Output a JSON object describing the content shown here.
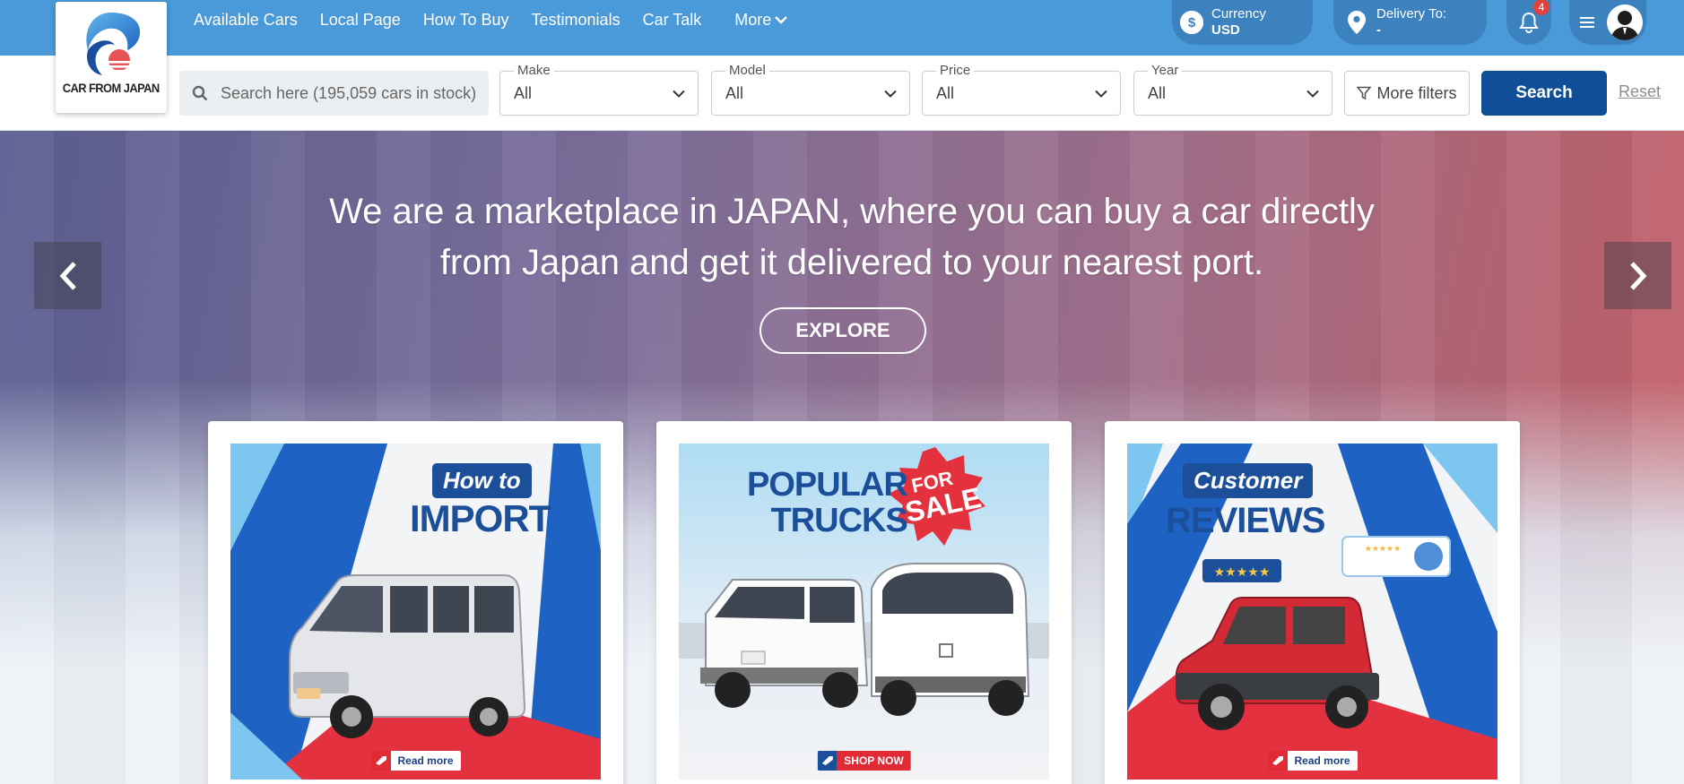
{
  "brand": {
    "logo_text": "CAR FROM JAPAN"
  },
  "nav": {
    "items": [
      "Available Cars",
      "Local Page",
      "How To Buy",
      "Testimonials",
      "Car Talk"
    ],
    "more_label": "More"
  },
  "header": {
    "currency_label": "Currency",
    "currency_value": "USD",
    "delivery_label": "Delivery To:",
    "delivery_value": "-",
    "notification_count": "4"
  },
  "search": {
    "placeholder": "Search here (195,059 cars in stock)",
    "filters": [
      {
        "label": "Make",
        "value": "All"
      },
      {
        "label": "Model",
        "value": "All"
      },
      {
        "label": "Price",
        "value": "All"
      },
      {
        "label": "Year",
        "value": "All"
      }
    ],
    "more_filters_label": "More filters",
    "search_label": "Search",
    "reset_label": "Reset"
  },
  "hero": {
    "headline_line1": "We are a marketplace in JAPAN, where you can buy a car directly",
    "headline_line2": "from Japan and get it delivered to your nearest port.",
    "explore_label": "EXPLORE"
  },
  "cards": [
    {
      "badge": "How to",
      "title": "IMPORT",
      "cta": "Read more"
    },
    {
      "title_line1": "POPULAR",
      "title_line2": "TRUCKS",
      "starburst_line1": "FOR",
      "starburst_line2": "SALE",
      "cta": "SHOP NOW"
    },
    {
      "badge": "Customer",
      "title": "REVIEWS",
      "cta": "Read more"
    }
  ],
  "colors": {
    "topbar": "#4a9ad9",
    "primary_button": "#104f97",
    "accent_red": "#e02b35",
    "badge_blue": "#1b4f9a"
  }
}
